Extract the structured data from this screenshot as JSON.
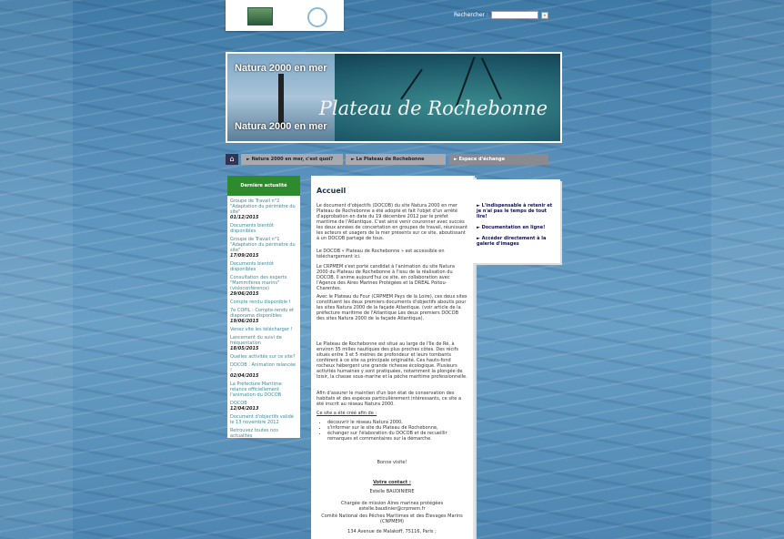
{
  "search": {
    "label": "Rechercher :",
    "button": "»"
  },
  "banner": {
    "top_text": "Natura 2000 en mer",
    "bottom_text": "Natura 2000 en mer",
    "title": "Plateau de Rochebonne"
  },
  "nav": {
    "home": "⌂",
    "items": [
      "► Natura 2000 en mer, c'est quoi?",
      "► Le Plateau de Rochebonne",
      "► Espace d'échange"
    ]
  },
  "sidebar": {
    "title": "Dernière actualité",
    "items": [
      {
        "text": "Groupe de Travail n°2 \"Adaptation du périmètre du site\"",
        "date": "01/12/2015"
      },
      {
        "text": "Documents bientôt disponibles",
        "date": ""
      },
      {
        "text": "Groupe de Travail n°1 \"Adaptation du périmètre du site\"",
        "date": "17/09/2015"
      },
      {
        "text": "Documents bientôt disponibles",
        "date": ""
      },
      {
        "text": "Consultation des experts \"Mammifères marins\" (visioconférence)",
        "date": "29/06/2015"
      },
      {
        "text": "Compte rendu disponible !",
        "date": ""
      },
      {
        "text": "7e COPIL : Compte-rendu et diaporama disponibles",
        "date": "19/06/2015"
      },
      {
        "text": "Venez vite les télécharger !",
        "date": ""
      },
      {
        "text": "Lancement du suivi de fréquentation",
        "date": "18/05/2015"
      },
      {
        "text": "Quelles activités sur ce site?",
        "date": ""
      },
      {
        "text": "DOCOB : Animation relancée !",
        "date": "02/04/2015"
      },
      {
        "text": "La Préfecture Maritime relance officiellement l'animation du DOCOB",
        "date": ""
      },
      {
        "text": "DOCOB",
        "date": "12/04/2013"
      },
      {
        "text": "Document d'objectifs validé le 13 novembre 2012",
        "date": ""
      },
      {
        "text": "Retrouvez toutes nos actualités",
        "date": ""
      }
    ]
  },
  "main": {
    "title": "Accueil",
    "p1": "Le document d'objectifs (DOCOB) du site Natura 2000 en mer Plateau de Rochebonne a été adopté et fait l'objet d'un arrêté d'approbation en date du 19 décembre 2012 par le préfet maritime de l'Atlantique. C'est ainsi venir couronner avec succès les deux années de concertation en groupes de travail, réunissant les acteurs et usagers de la mer présents sur ce site, aboutissant à un DOCOB partagé de tous.",
    "p2": "Le DOCOB « Plateau de Rochebonne » est accessible en téléchargement ici.",
    "p3": "Le CRPMEM s'est porté candidat à l'animation du site Natura 2000 du Plateau de Rochebonne à l'issu de la réalisation du DOCOB. Il anime aujourd'hui ce site, en collaboration avec l'Agence des Aires Marines Protégées et la DREAL Poitou-Charentes.",
    "p4": "Avec le Plateau du Four (CRPMEM Pays de la Loire), ces deux sites constituent les deux premiers documents d'objectifs aboutis pour les sites Natura 2000 de la façade Atlantique. (voir article de la préfecture maritime de l'Atlantique Les deux premiers DOCOB des sites Natura 2000 de la façade Atlantique).",
    "p5": "Le Plateau de Rochebonne est situé au large de l'île de Ré, à environ 35 milles nautiques des plus proches côtes. Des récifs situés entre 3 et 5 mètres de profondeur et leurs tombants confèrent à ce site sa principale originalité. Ces hauts-fond rocheux hébergent une grande richesse écologique. Plusieurs activités humaines y sont pratiquées, notamment la plongée de loisir, la chasse sous-marine et la pêche maritime professionnelle.",
    "p6": "Afin d'assurer le maintien d'un bon état de conservation des habitats et des espèces particulièrement intéressants, ce site a été inscrit au réseau Natura 2000.",
    "p7": "Ce site a été créé afin de :",
    "bullets": [
      "découvrir le réseau Natura 2000,",
      "s'informer sur le site du Plateau de Rochebonne,",
      "échanger sur l'élaboration du DOCOB et de recueillir remarques et commentaires sur la démarche."
    ],
    "sign": "Bonne visite!",
    "contact_title": "Votre contact :",
    "contact_name": "Estelle BAUDINIERE",
    "contact_role": "Chargée de mission Aires marines protégées estelle.baudinier@crpmem.fr",
    "contact_org": "Comité National des Pêches Maritimes et des Élevages Marins (CNPMEM)",
    "contact_addr": "134 Avenue de Malakoff, 75116, Paris ;"
  },
  "right": {
    "links": [
      "► L'indispensable à retenir et je n'ai pas le temps de tout lire!",
      "► Documentation en ligne!",
      "► Accéder directement à la galerie d'images"
    ]
  }
}
